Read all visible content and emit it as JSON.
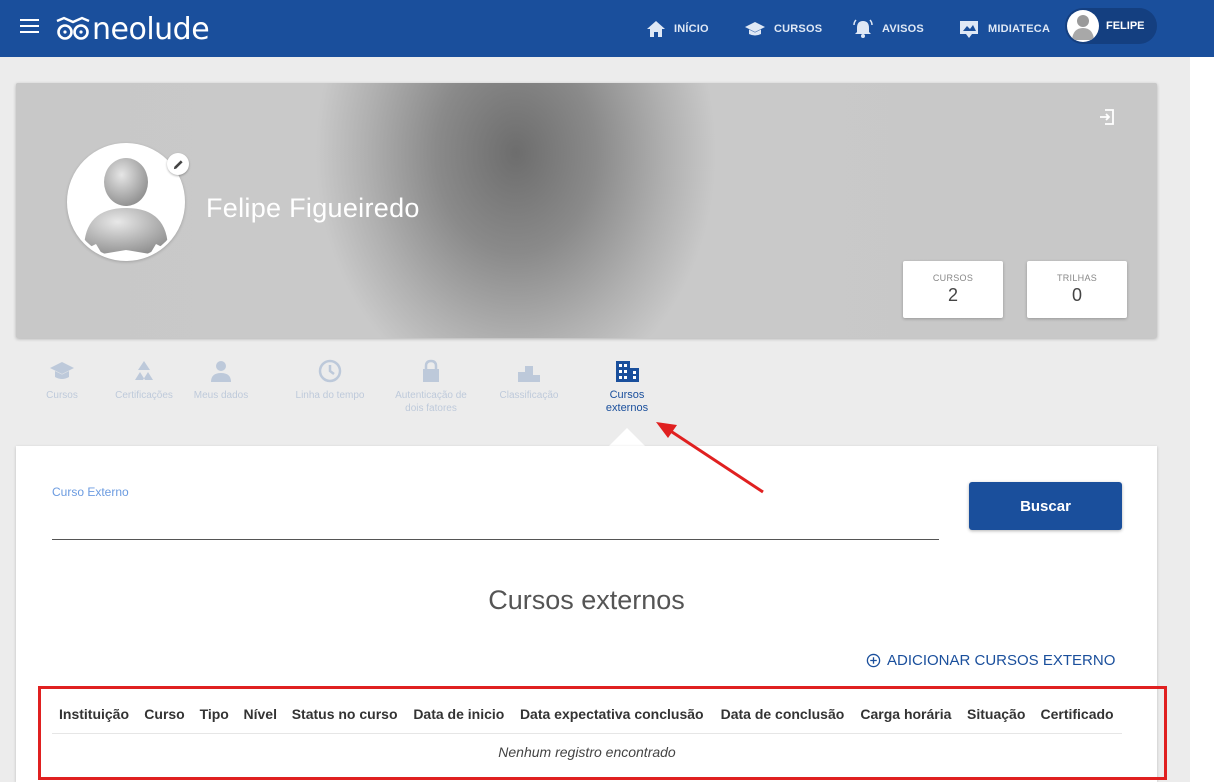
{
  "header": {
    "logo_text": "neolude",
    "nav": [
      {
        "label": "INÍCIO",
        "icon": "home-icon"
      },
      {
        "label": "CURSOS",
        "icon": "graduation-cap-icon"
      },
      {
        "label": "AVISOS",
        "icon": "bell-icon"
      },
      {
        "label": "MIDIATECA",
        "icon": "media-icon"
      }
    ],
    "user_name": "FELIPE"
  },
  "profile": {
    "name": "Felipe Figueiredo",
    "stats": [
      {
        "label": "CURSOS",
        "value": "2"
      },
      {
        "label": "TRILHAS",
        "value": "0"
      }
    ]
  },
  "tabs": [
    {
      "label": "Cursos",
      "icon": "graduation-cap-icon",
      "active": false
    },
    {
      "label": "Certificações",
      "icon": "recycle-icon",
      "active": false
    },
    {
      "label": "Meus dados",
      "icon": "person-icon",
      "active": false
    },
    {
      "label": "Linha do tempo",
      "icon": "clock-icon",
      "active": false
    },
    {
      "label": "Autenticação de dois fatores",
      "icon": "lock-icon",
      "active": false
    },
    {
      "label": "Classificação",
      "icon": "podium-icon",
      "active": false
    },
    {
      "label": "Cursos externos",
      "icon": "building-icon",
      "active": true
    }
  ],
  "search": {
    "field_label": "Curso Externo",
    "field_value": "",
    "button_label": "Buscar"
  },
  "section": {
    "title": "Cursos externos",
    "add_label": "ADICIONAR CURSOS EXTERNO"
  },
  "table": {
    "columns": [
      "Instituição",
      "Curso",
      "Tipo",
      "Nível",
      "Status no curso",
      "Data de inicio",
      "Data expectativa conclusão",
      "Data de conclusão",
      "Carga horária",
      "Situação",
      "Certificado"
    ],
    "empty_message": "Nenhum registro encontrado"
  },
  "colors": {
    "primary": "#1a4f9c",
    "annotation": "#e02020"
  }
}
